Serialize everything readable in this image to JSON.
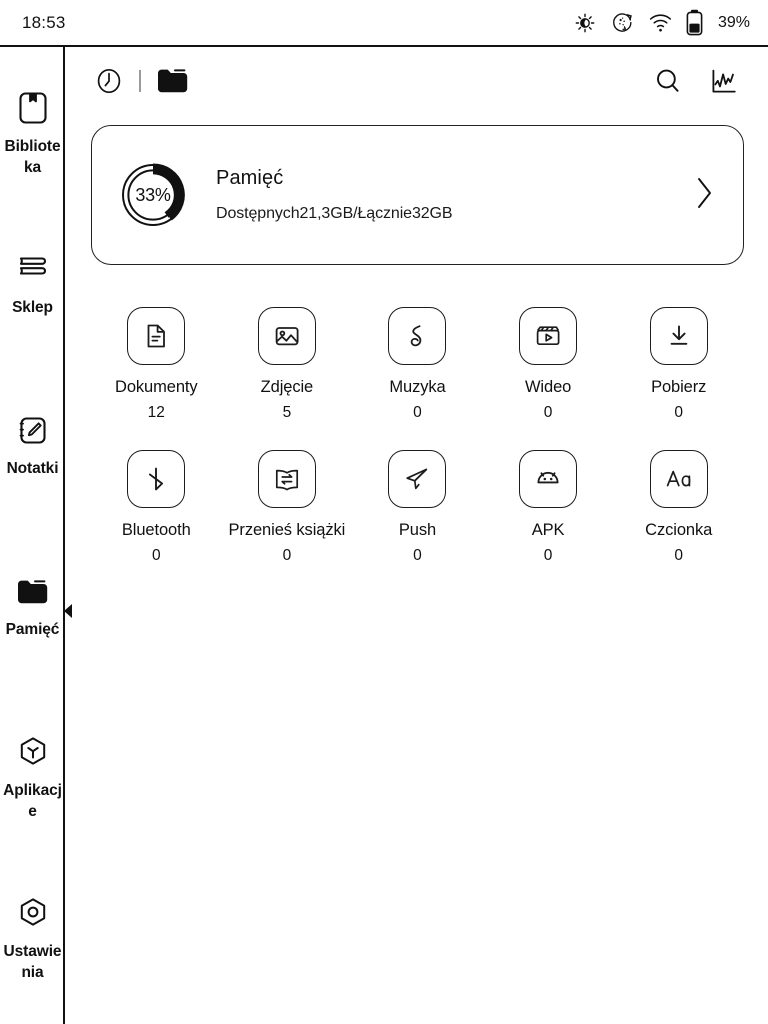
{
  "statusbar": {
    "time": "18:53",
    "battery_percent": "39%",
    "icons": [
      "brightness-icon",
      "eink-refresh-icon",
      "wifi-icon",
      "battery-icon"
    ]
  },
  "sidebar": {
    "items": [
      {
        "label": "Biblioteka",
        "icon": "library-book-icon",
        "active": false
      },
      {
        "label": "Sklep",
        "icon": "store-books-icon",
        "active": false
      },
      {
        "label": "Notatki",
        "icon": "note-pencil-icon",
        "active": false
      },
      {
        "label": "Pamięć",
        "icon": "folder-filled-icon",
        "active": true
      },
      {
        "label": "Aplikacje",
        "icon": "apps-hexagon-icon",
        "active": false
      },
      {
        "label": "Ustawienia",
        "icon": "settings-hexagon-icon",
        "active": false
      }
    ]
  },
  "toolbar": {
    "left": [
      {
        "name": "recent-clock-tab",
        "icon": "clock-icon",
        "active": false
      },
      {
        "name": "files-folder-tab",
        "icon": "folder-filled-icon",
        "active": true
      }
    ],
    "right": [
      {
        "name": "search-button",
        "icon": "search-icon"
      },
      {
        "name": "statistics-button",
        "icon": "line-chart-icon"
      }
    ]
  },
  "storage_card": {
    "percent_label": "33%",
    "percent_value": 33,
    "title": "Pamięć",
    "subtitle": "Dostępnych21,3GB/Łącznie32GB",
    "chevron": "chevron-right-icon"
  },
  "categories": [
    {
      "label": "Dokumenty",
      "count": "12",
      "icon": "document-icon"
    },
    {
      "label": "Zdjęcie",
      "count": "5",
      "icon": "image-icon"
    },
    {
      "label": "Muzyka",
      "count": "0",
      "icon": "music-note-icon"
    },
    {
      "label": "Wideo",
      "count": "0",
      "icon": "video-clapper-icon"
    },
    {
      "label": "Pobierz",
      "count": "0",
      "icon": "download-icon"
    },
    {
      "label": "Bluetooth",
      "count": "0",
      "icon": "bluetooth-icon"
    },
    {
      "label": "Przenieś książki",
      "count": "0",
      "icon": "book-transfer-icon"
    },
    {
      "label": "Push",
      "count": "0",
      "icon": "paper-plane-icon"
    },
    {
      "label": "APK",
      "count": "0",
      "icon": "android-icon"
    },
    {
      "label": "Czcionka",
      "count": "0",
      "icon": "font-aa-icon"
    }
  ],
  "colors": {
    "foreground": "#111111",
    "background": "#ffffff",
    "muted": "#9a9a9a"
  }
}
